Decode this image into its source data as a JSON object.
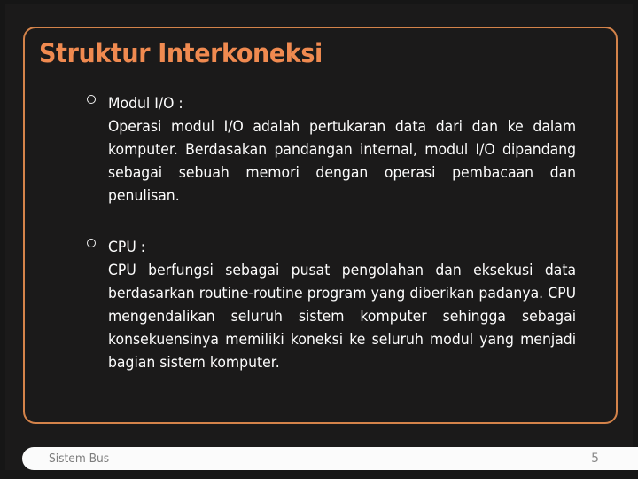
{
  "slide": {
    "title": "Struktur Interkoneksi",
    "background_color": "#1b1a1a",
    "accent_color": "#d4834a",
    "title_color": "#f08a50",
    "body_text_color": "#fdfdfd"
  },
  "bullets": [
    {
      "marker": "hollow-circle",
      "heading": "Modul I/O :",
      "text": "Operasi modul I/O adalah pertukaran data dari dan ke dalam komputer. Berdasakan pandangan internal, modul I/O dipandang sebagai sebuah memori dengan operasi pembacaan dan penulisan."
    },
    {
      "marker": "hollow-circle",
      "heading": "CPU :",
      "text": "CPU berfungsi sebagai pusat pengolahan dan eksekusi data berdasarkan routine-routine program yang diberikan padanya. CPU mengendalikan seluruh sistem komputer sehingga sebagai konsekuensinya memiliki koneksi ke seluruh modul yang menjadi bagian sistem komputer."
    }
  ],
  "footer": {
    "label": "Sistem Bus",
    "page_number": "5",
    "text_color": "#7d7d7d",
    "background_color": "#fbfbfb"
  }
}
